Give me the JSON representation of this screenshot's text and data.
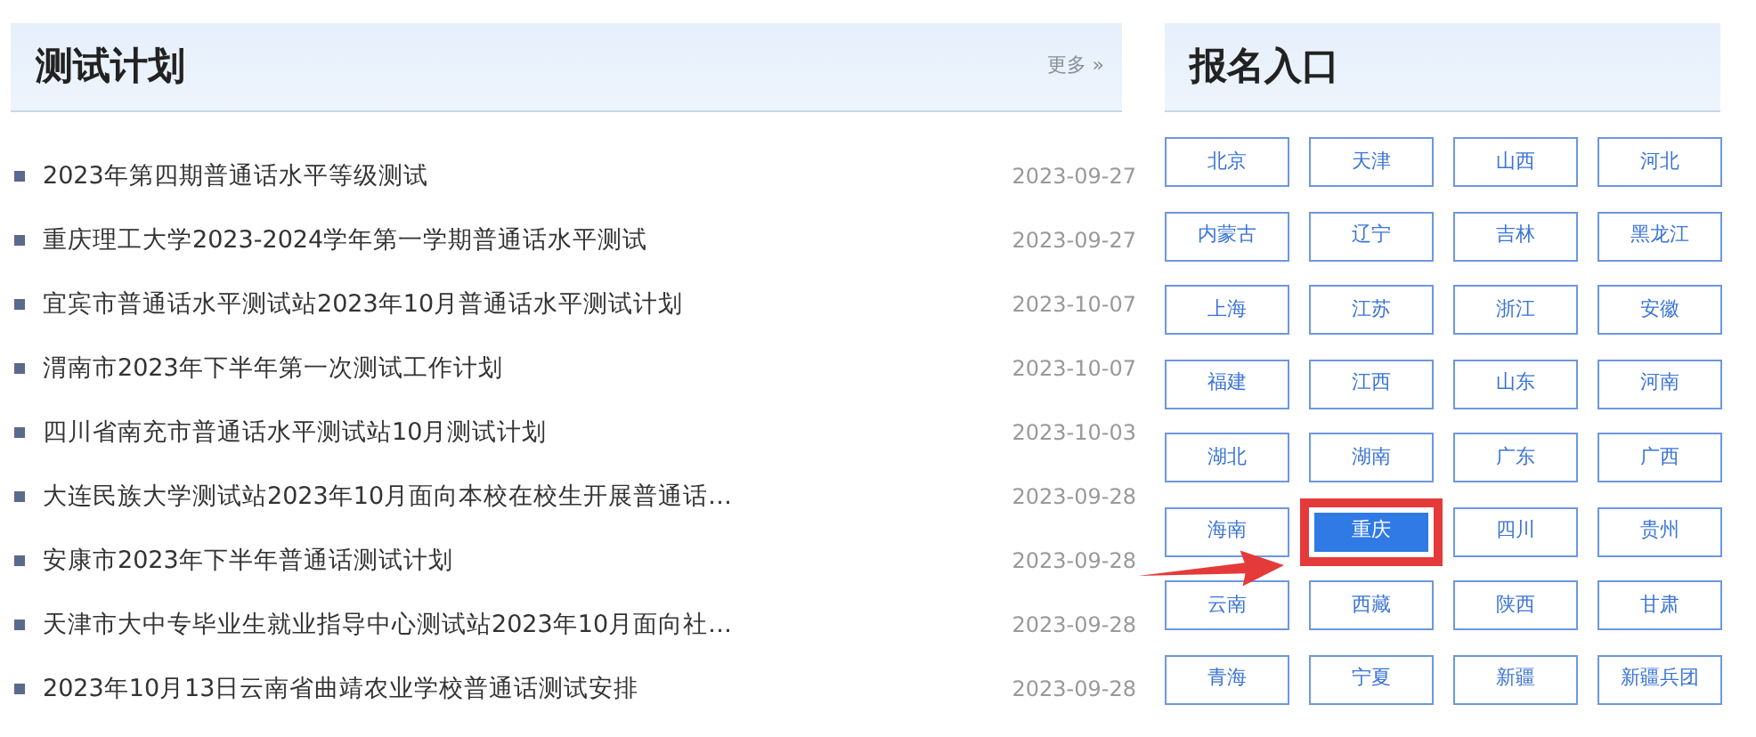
{
  "plan_panel": {
    "title": "测试计划",
    "more_link": "更多",
    "more_icon": "»",
    "items": [
      {
        "title": "2023年第四期普通话水平等级测试",
        "date": "2023-09-27"
      },
      {
        "title": "重庆理工大学2023-2024学年第一学期普通话水平测试",
        "date": "2023-09-27"
      },
      {
        "title": "宜宾市普通话水平测试站2023年10月普通话水平测试计划",
        "date": "2023-10-07"
      },
      {
        "title": "渭南市2023年下半年第一次测试工作计划",
        "date": "2023-10-07"
      },
      {
        "title": "四川省南充市普通话水平测试站10月测试计划",
        "date": "2023-10-03"
      },
      {
        "title": "大连民族大学测试站2023年10月面向本校在校生开展普通话…",
        "date": "2023-09-28"
      },
      {
        "title": "安康市2023年下半年普通话测试计划",
        "date": "2023-09-28"
      },
      {
        "title": "天津市大中专毕业生就业指导中心测试站2023年10月面向社…",
        "date": "2023-09-28"
      },
      {
        "title": "2023年10月13日云南省曲靖农业学校普通话测试安排",
        "date": "2023-09-28"
      }
    ]
  },
  "signup_panel": {
    "title": "报名入口",
    "regions": [
      {
        "label": "北京",
        "selected": false,
        "highlighted": false
      },
      {
        "label": "天津",
        "selected": false,
        "highlighted": false
      },
      {
        "label": "山西",
        "selected": false,
        "highlighted": false
      },
      {
        "label": "河北",
        "selected": false,
        "highlighted": false
      },
      {
        "label": "内蒙古",
        "selected": false,
        "highlighted": false
      },
      {
        "label": "辽宁",
        "selected": false,
        "highlighted": false
      },
      {
        "label": "吉林",
        "selected": false,
        "highlighted": false
      },
      {
        "label": "黑龙江",
        "selected": false,
        "highlighted": false
      },
      {
        "label": "上海",
        "selected": false,
        "highlighted": false
      },
      {
        "label": "江苏",
        "selected": false,
        "highlighted": false
      },
      {
        "label": "浙江",
        "selected": false,
        "highlighted": false
      },
      {
        "label": "安徽",
        "selected": false,
        "highlighted": false
      },
      {
        "label": "福建",
        "selected": false,
        "highlighted": false
      },
      {
        "label": "江西",
        "selected": false,
        "highlighted": false
      },
      {
        "label": "山东",
        "selected": false,
        "highlighted": false
      },
      {
        "label": "河南",
        "selected": false,
        "highlighted": false
      },
      {
        "label": "湖北",
        "selected": false,
        "highlighted": false
      },
      {
        "label": "湖南",
        "selected": false,
        "highlighted": false
      },
      {
        "label": "广东",
        "selected": false,
        "highlighted": false
      },
      {
        "label": "广西",
        "selected": false,
        "highlighted": false
      },
      {
        "label": "海南",
        "selected": false,
        "highlighted": false
      },
      {
        "label": "重庆",
        "selected": true,
        "highlighted": true
      },
      {
        "label": "四川",
        "selected": false,
        "highlighted": false
      },
      {
        "label": "贵州",
        "selected": false,
        "highlighted": false
      },
      {
        "label": "云南",
        "selected": false,
        "highlighted": false
      },
      {
        "label": "西藏",
        "selected": false,
        "highlighted": false
      },
      {
        "label": "陕西",
        "selected": false,
        "highlighted": false
      },
      {
        "label": "甘肃",
        "selected": false,
        "highlighted": false
      },
      {
        "label": "青海",
        "selected": false,
        "highlighted": false
      },
      {
        "label": "宁夏",
        "selected": false,
        "highlighted": false
      },
      {
        "label": "新疆",
        "selected": false,
        "highlighted": false
      },
      {
        "label": "新疆兵团",
        "selected": false,
        "highlighted": false
      }
    ]
  }
}
